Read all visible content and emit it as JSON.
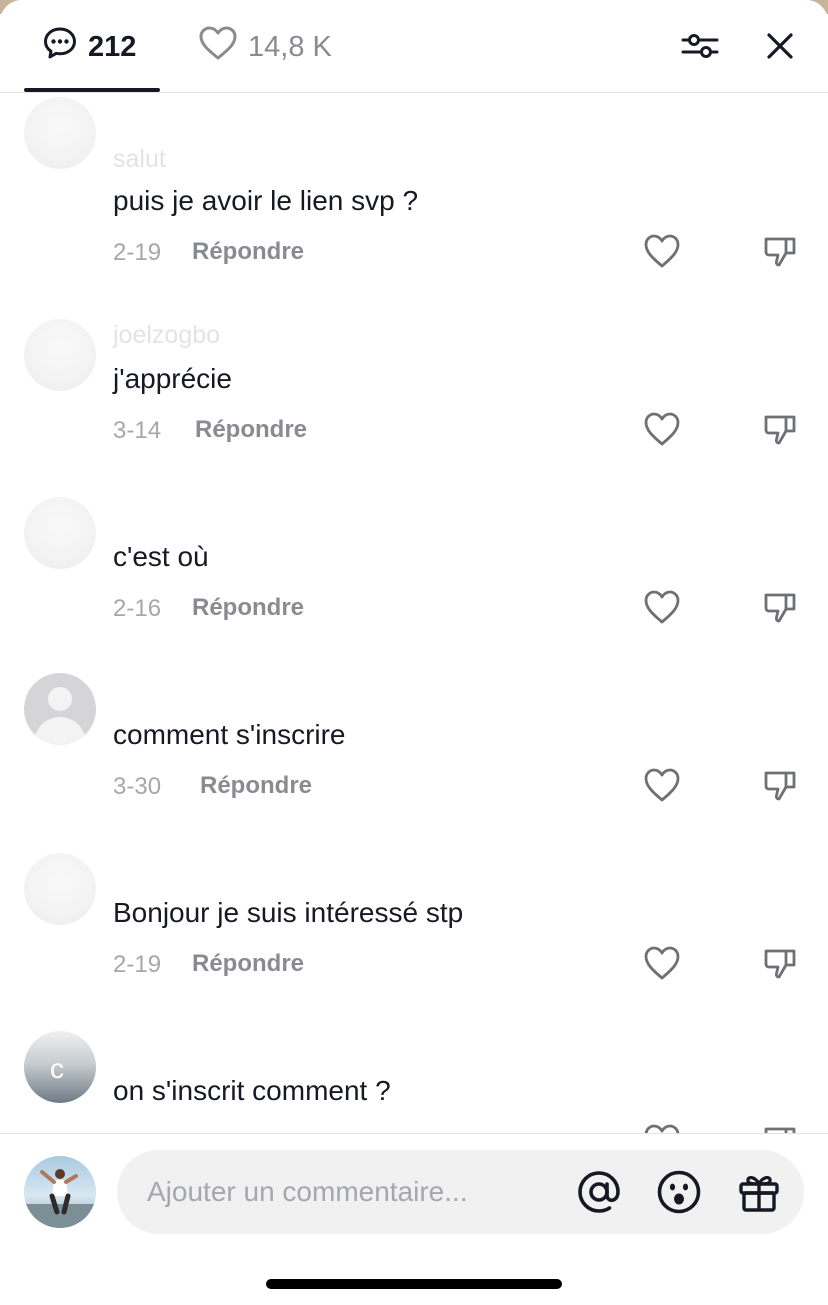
{
  "header": {
    "comments_count": "212",
    "likes_count": "14,8 K"
  },
  "comments": [
    {
      "username": "salut",
      "text": "puis je avoir le lien svp ?",
      "date": "2-19",
      "reply_label": "Répondre"
    },
    {
      "username": "joelzogbo",
      "text": "j'apprécie",
      "date": "3-14",
      "reply_label": "Répondre"
    },
    {
      "username": "",
      "text": "c'est où",
      "date": "2-16",
      "reply_label": "Répondre"
    },
    {
      "username": "",
      "text": "comment s'inscrire",
      "date": "3-30",
      "reply_label": "Répondre"
    },
    {
      "username": "",
      "text": "Bonjour je suis intéressé stp",
      "date": "2-19",
      "reply_label": "Répondre"
    },
    {
      "username": "",
      "text": "on s'inscrit comment ?",
      "date": "",
      "reply_label": ""
    }
  ],
  "composer": {
    "placeholder": "Ajouter un commentaire..."
  }
}
